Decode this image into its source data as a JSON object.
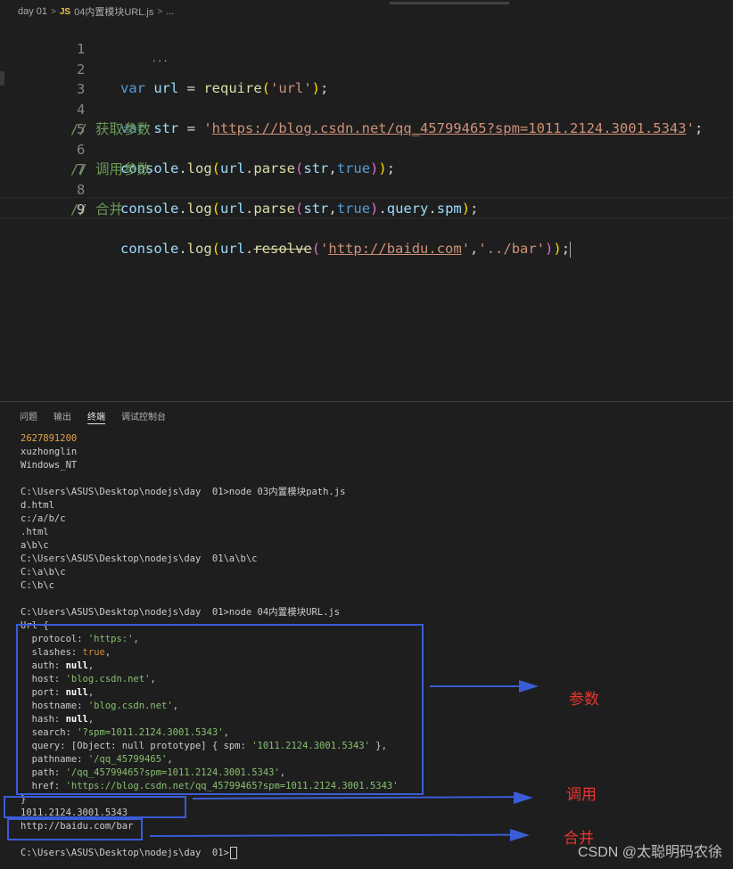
{
  "breadcrumb": {
    "folder": "day 01",
    "sep": ">",
    "lang_badge": "JS",
    "file": "04内置模块URL.js",
    "sep2": ">",
    "tail": "..."
  },
  "editor": {
    "lines": [
      {
        "n": "1"
      },
      {
        "n": "2"
      },
      {
        "n": "3"
      },
      {
        "n": "4"
      },
      {
        "n": "5"
      },
      {
        "n": "6"
      },
      {
        "n": "7"
      },
      {
        "n": "8"
      },
      {
        "n": "9"
      }
    ],
    "code": {
      "l1_kw": "var",
      "l1_var": " url",
      "l1_eq": " = ",
      "l1_fn": "require",
      "l1_p1": "(",
      "l1_str": "'url'",
      "l1_p2": ")",
      "l1_semi": ";",
      "l3_kw": "var",
      "l3_var": " str",
      "l3_eq": " = ",
      "l3_q1": "'",
      "l3_url": "https://blog.csdn.net/qq_45799465?spm=1011.2124.3001.5343",
      "l3_q2": "'",
      "l3_semi": ";",
      "l4_cm": "// 获取参数",
      "l5_obj": "console",
      "l5_dot": ".",
      "l5_fn": "log",
      "l5_p1": "(",
      "l5_url": "url",
      "l5_dot2": ".",
      "l5_fn2": "parse",
      "l5_p2": "(",
      "l5_arg": "str",
      "l5_comma": ",",
      "l5_bool": "true",
      "l5_p3": ")",
      "l5_p4": ")",
      "l5_semi": ";",
      "l6_cm": "// 调用参数",
      "l7_obj": "console",
      "l7_dot": ".",
      "l7_fn": "log",
      "l7_p1": "(",
      "l7_url": "url",
      "l7_dot2": ".",
      "l7_fn2": "parse",
      "l7_p2": "(",
      "l7_arg": "str",
      "l7_comma": ",",
      "l7_bool": "true",
      "l7_p3": ")",
      "l7_dot3": ".",
      "l7_q": "query",
      "l7_dot4": ".",
      "l7_spm": "spm",
      "l7_p4": ")",
      "l7_semi": ";",
      "l8_cm": "// 合并",
      "l9_obj": "console",
      "l9_dot": ".",
      "l9_fn": "log",
      "l9_p1": "(",
      "l9_url": "url",
      "l9_dot2": ".",
      "l9_fn2": "resolve",
      "l9_p2": "(",
      "l9_s1q1": "'",
      "l9_s1": "http://baidu.com",
      "l9_s1q2": "'",
      "l9_comma": ",",
      "l9_s2": "'../bar'",
      "l9_p3": ")",
      "l9_p4": ")",
      "l9_semi": ";"
    },
    "dots": "..."
  },
  "panel": {
    "tabs": [
      "问题",
      "输出",
      "终端",
      "调试控制台"
    ],
    "active_tab": "终端",
    "terminal": {
      "l01": "2627891200",
      "l02": "xuzhonglin",
      "l03": "Windows_NT",
      "l05": "C:\\Users\\ASUS\\Desktop\\nodejs\\day  01>node 03内置模块path.js",
      "l06": "d.html",
      "l07": "c:/a/b/c",
      "l08": ".html",
      "l09": "a\\b\\c",
      "l10": "C:\\Users\\ASUS\\Desktop\\nodejs\\day  01\\a\\b\\c",
      "l11": "C:\\a\\b\\c",
      "l12": "C:\\b\\c",
      "l14": "C:\\Users\\ASUS\\Desktop\\nodejs\\day  01>node 04内置模块URL.js",
      "l15": "Url {",
      "protocol_k": "  protocol: ",
      "protocol_v": "'https:'",
      "slashes_k": "  slashes: ",
      "slashes_v": "true",
      "auth_k": "  auth: ",
      "auth_v": "null",
      "host_k": "  host: ",
      "host_v": "'blog.csdn.net'",
      "port_k": "  port: ",
      "port_v": "null",
      "hostname_k": "  hostname: ",
      "hostname_v": "'blog.csdn.net'",
      "hash_k": "  hash: ",
      "hash_v": "null",
      "search_k": "  search: ",
      "search_v": "'?spm=1011.2124.3001.5343'",
      "query_k": "  query: [Object: null prototype] { spm: ",
      "query_v": "'1011.2124.3001.5343'",
      "query_end": " },",
      "pathname_k": "  pathname: ",
      "pathname_v": "'/qq_45799465'",
      "path_k": "  path: ",
      "path_v": "'/qq_45799465?spm=1011.2124.3001.5343'",
      "href_k": "  href: ",
      "href_v": "'https://blog.csdn.net/qq_45799465?spm=1011.2124.3001.5343'",
      "close": "}",
      "spm_out": "1011.2124.3001.5343",
      "resolve_out": "http://baidu.com/bar",
      "prompt": "C:\\Users\\ASUS\\Desktop\\nodejs\\day  01>"
    }
  },
  "annotations": {
    "params": "参数",
    "call": "调用",
    "merge": "合并"
  },
  "watermark": "CSDN @太聪明码农徐",
  "colors": {
    "annotation_red": "#e8362e",
    "annotation_blue": "#3a5cd6"
  }
}
